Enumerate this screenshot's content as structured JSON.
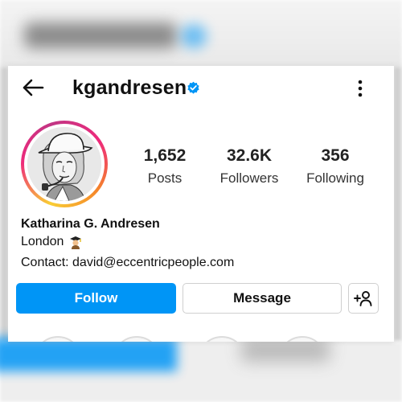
{
  "profile": {
    "username": "kgandresen",
    "full_name": "Katharina G. Andresen",
    "bio_lines": [
      "London",
      "Contact: david@eccentricpeople.com"
    ],
    "bio_emoji_icon": "graduation-student-emoji-icon"
  },
  "stats": [
    {
      "value": "1,652",
      "label": "Posts"
    },
    {
      "value": "32.6K",
      "label": "Followers"
    },
    {
      "value": "356",
      "label": "Following"
    }
  ],
  "actions": {
    "follow": "Follow",
    "message": "Message",
    "suggest_icon": "add-person-icon"
  },
  "icons": {
    "back": "back-arrow-icon",
    "verified": "verified-badge-icon",
    "more": "more-vertical-icon"
  },
  "colors": {
    "accent": "#0095f6",
    "verified": "#0095f6",
    "text": "#111111"
  }
}
